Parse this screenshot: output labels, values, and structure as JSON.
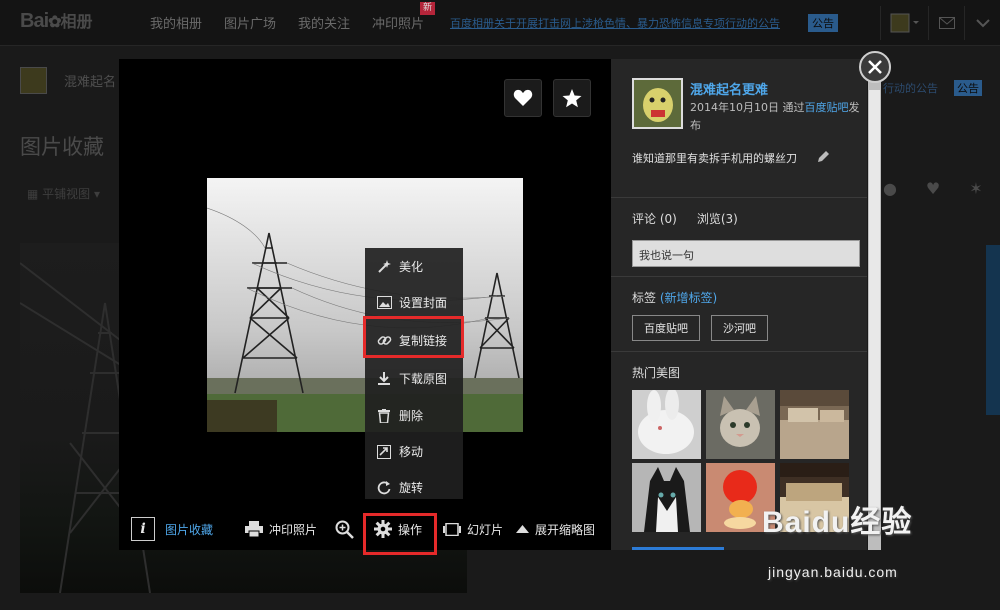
{
  "header": {
    "logo_text": "Bai",
    "logo_paw": "✿",
    "logo_suffix": "相册",
    "nav": [
      "我的相册",
      "图片广场",
      "我的关注",
      "冲印照片"
    ],
    "new_badge": "新",
    "notice": "百度相册关于开展打击网上涉枪色情、暴力恐怖信息专项行动的公告",
    "notice_badge": "公告"
  },
  "background_page": {
    "username": "混难起名",
    "notice_tail": "行动的公告",
    "notice_badge": "公告",
    "album_title": "图片收藏",
    "view_mode": "平铺视图"
  },
  "viewer": {
    "action_menu": [
      {
        "label": "美化",
        "icon": "magic-wand-icon"
      },
      {
        "label": "设置封面",
        "icon": "image-icon"
      },
      {
        "label": "复制链接",
        "icon": "link-icon"
      },
      {
        "label": "下载原图",
        "icon": "download-icon"
      },
      {
        "label": "删除",
        "icon": "trash-icon"
      },
      {
        "label": "移动",
        "icon": "move-icon"
      },
      {
        "label": "旋转",
        "icon": "rotate-icon"
      }
    ],
    "highlight_color": "#e52a2a",
    "bottom_bar": {
      "info_icon": "i",
      "album_link": "图片收藏",
      "print": "冲印照片",
      "operate": "操作",
      "slideshow": "幻灯片",
      "expand_thumbs": "展开缩略图"
    }
  },
  "panel": {
    "username": "混难起名更难",
    "meta_date": "2014年10月10日 通过",
    "meta_source": "百度贴吧",
    "meta_suffix": "发布",
    "description": "谁知道那里有卖拆手机用的螺丝刀",
    "comments_tab": "评论 (0)",
    "views_tab": "浏览(3)",
    "comment_placeholder": "我也说一句",
    "tags_label": "标签",
    "add_tag": "(新增标签)",
    "tags": [
      "百度贴吧",
      "沙河吧"
    ],
    "hot_title": "热门美图",
    "accent_color": "#4fa7ea"
  },
  "watermark": {
    "brand": "Baidu经验",
    "url": "jingyan.baidu.com"
  }
}
